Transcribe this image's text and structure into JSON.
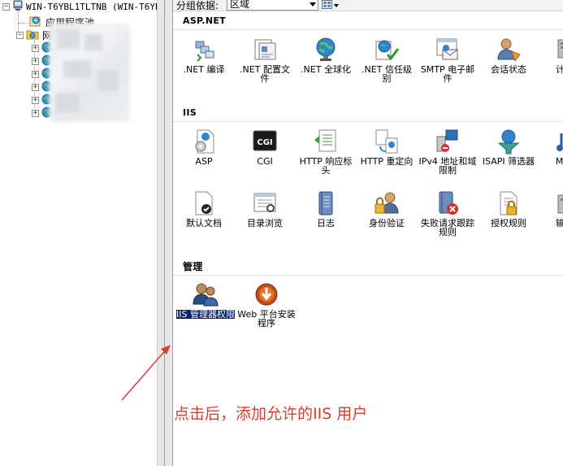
{
  "tree": {
    "server_label": "WIN-T6YBL1TLTNB (WIN-T6YBL",
    "app_pools_label": "应用程序池",
    "sites_label": "网站",
    "expand_glyph": "+",
    "collapse_glyph": "−"
  },
  "toolbar": {
    "group_by_label": "分组依据:",
    "group_by_value": "区域"
  },
  "sections": {
    "aspnet": {
      "title": "ASP.NET",
      "items": [
        {
          "label": ".NET 编译",
          "icon": "dotnet-compilation-icon"
        },
        {
          "label": ".NET 配置文件",
          "icon": "dotnet-profile-icon"
        },
        {
          "label": ".NET 全球化",
          "icon": "dotnet-globalization-icon"
        },
        {
          "label": ".NET 信任级别",
          "icon": "dotnet-trust-levels-icon"
        },
        {
          "label": "SMTP 电子邮件",
          "icon": "smtp-email-icon"
        },
        {
          "label": "会话状态",
          "icon": "session-state-icon"
        },
        {
          "label": "计算",
          "icon": "machine-key-icon"
        }
      ]
    },
    "iis": {
      "title": "IIS",
      "items": [
        {
          "label": "ASP",
          "icon": "asp-icon"
        },
        {
          "label": "CGI",
          "icon": "cgi-icon"
        },
        {
          "label": "HTTP 响应标头",
          "icon": "http-response-headers-icon"
        },
        {
          "label": "HTTP 重定向",
          "icon": "http-redirect-icon"
        },
        {
          "label": "IPv4 地址和域限制",
          "icon": "ipv4-restrictions-icon"
        },
        {
          "label": "ISAPI 筛选器",
          "icon": "isapi-filters-icon"
        },
        {
          "label": "MIM",
          "icon": "mime-types-icon"
        },
        {
          "label": "默认文档",
          "icon": "default-document-icon"
        },
        {
          "label": "目录浏览",
          "icon": "directory-browsing-icon"
        },
        {
          "label": "日志",
          "icon": "logging-icon"
        },
        {
          "label": "身份验证",
          "icon": "authentication-icon"
        },
        {
          "label": "失败请求跟踪规则",
          "icon": "failed-request-tracing-icon"
        },
        {
          "label": "授权规则",
          "icon": "authorization-rules-icon"
        },
        {
          "label": "输出",
          "icon": "output-caching-icon"
        }
      ]
    },
    "management": {
      "title": "管理",
      "items": [
        {
          "label": "IIS 管理器权限",
          "icon": "iis-manager-permissions-icon"
        },
        {
          "label": "Web 平台安装程序",
          "icon": "web-platform-installer-icon"
        }
      ]
    }
  },
  "annotation": {
    "text": "点击后，添加允许的IIS 用户",
    "color": "#e03a2c"
  },
  "colors": {
    "selection": "#0a246a",
    "splitter": "#e7e7e7"
  }
}
